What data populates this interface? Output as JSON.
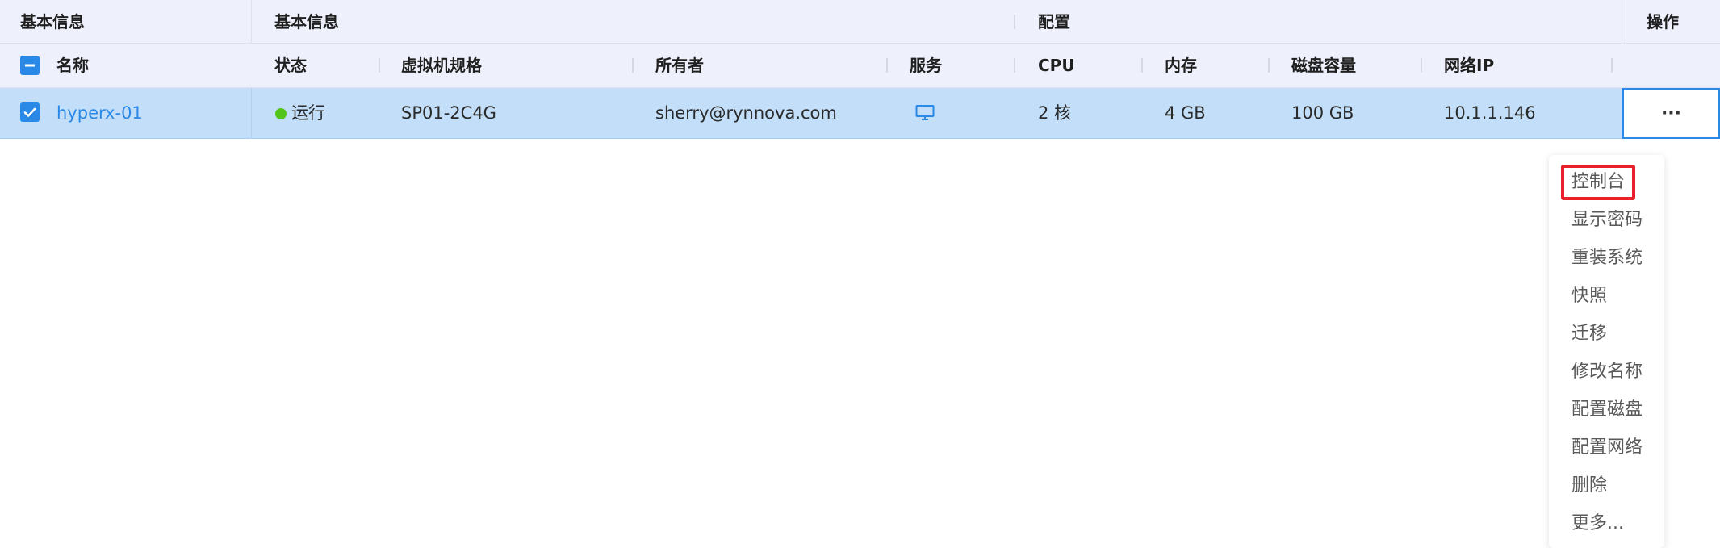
{
  "group_headers": {
    "g1": "基本信息",
    "g2": "基本信息",
    "g3": "配置",
    "g4": "操作"
  },
  "columns": {
    "name": "名称",
    "status": "状态",
    "spec": "虚拟机规格",
    "owner": "所有者",
    "service": "服务",
    "cpu": "CPU",
    "memory": "内存",
    "disk": "磁盘容量",
    "ip": "网络IP"
  },
  "rows": [
    {
      "name": "hyperx-01",
      "status": "运行",
      "spec": "SP01-2C4G",
      "owner": "sherry@rynnova.com",
      "service_icon": "monitor-icon",
      "cpu": "2 核",
      "memory": "4 GB",
      "disk": "100 GB",
      "ip": "10.1.1.146",
      "ops": "···"
    }
  ],
  "menu": {
    "items": [
      "控制台",
      "显示密码",
      "重装系统",
      "快照",
      "迁移",
      "修改名称",
      "配置磁盘",
      "配置网络",
      "删除",
      "更多..."
    ]
  },
  "colors": {
    "header_bg": "#eef0fb",
    "row_selected_bg": "#c2def8",
    "accent": "#2a88e6",
    "link": "#2a88e6",
    "status_running": "#52c41a",
    "highlight_box": "#e8202a"
  },
  "icons": {
    "select_all": "minus-checkbox-icon",
    "row_select": "checked-checkbox-icon",
    "status": "green-dot-icon",
    "service": "monitor-icon",
    "ops": "more-dots-icon"
  }
}
